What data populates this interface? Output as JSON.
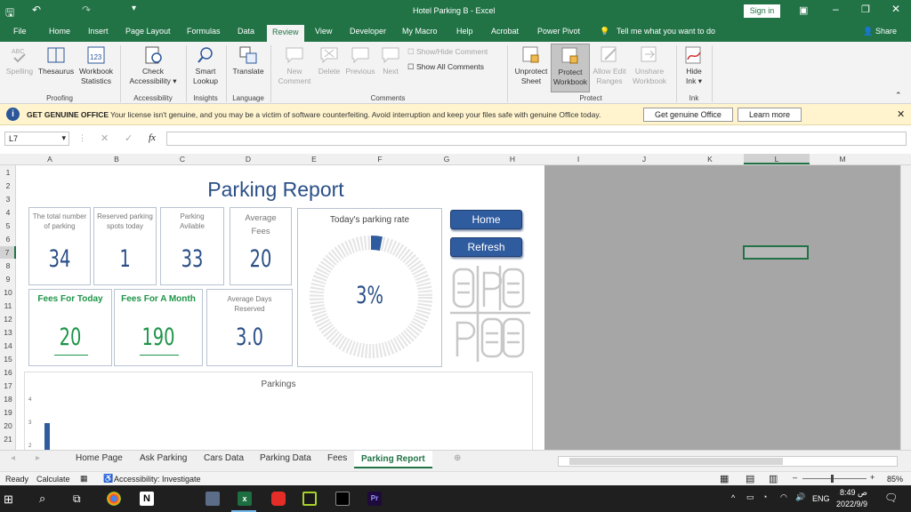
{
  "titlebar": {
    "title": "Hotel Parking B  -  Excel",
    "sign_in": "Sign in"
  },
  "menu": [
    "File",
    "Home",
    "Insert",
    "Page Layout",
    "Formulas",
    "Data",
    "Review",
    "View",
    "Developer",
    "My Macro",
    "Help",
    "Acrobat",
    "Power Pivot"
  ],
  "tell_me": "Tell me what you want to do",
  "share": "Share",
  "ribbon": {
    "spelling": "Spelling",
    "thesaurus": "Thesaurus",
    "wb_stats_1": "Workbook",
    "wb_stats_2": "Statistics",
    "proofing": "Proofing",
    "check_acc_1": "Check",
    "check_acc_2": "Accessibility",
    "accessibility": "Accessibility",
    "smart_1": "Smart",
    "smart_2": "Lookup",
    "insights": "Insights",
    "translate": "Translate",
    "language": "Language",
    "new_comment_1": "New",
    "new_comment_2": "Comment",
    "delete": "Delete",
    "previous": "Previous",
    "next": "Next",
    "show_hide": "Show/Hide Comment",
    "show_all": "Show All Comments",
    "comments": "Comments",
    "unprotect_1": "Unprotect",
    "unprotect_2": "Sheet",
    "protect_wb_1": "Protect",
    "protect_wb_2": "Workbook",
    "allow_1": "Allow Edit",
    "allow_2": "Ranges",
    "unshare_1": "Unshare",
    "unshare_2": "Workbook",
    "protect": "Protect",
    "hide_ink_1": "Hide",
    "hide_ink_2": "Ink",
    "ink": "Ink"
  },
  "info": {
    "title": "GET GENUINE OFFICE",
    "msg": "Your license isn't genuine, and you may be a victim of software counterfeiting. Avoid interruption and keep your files safe with genuine Office today.",
    "btn1": "Get genuine Office",
    "btn2": "Learn more"
  },
  "namebox": "L7",
  "columns": [
    "A",
    "B",
    "C",
    "D",
    "E",
    "F",
    "G",
    "H",
    "I",
    "J",
    "K",
    "L",
    "M"
  ],
  "rows": [
    "1",
    "2",
    "3",
    "4",
    "5",
    "6",
    "7",
    "8",
    "9",
    "10",
    "11",
    "12",
    "13",
    "14",
    "15",
    "16",
    "17",
    "18",
    "19",
    "20",
    "21"
  ],
  "report": {
    "title": "Parking Report",
    "total_label": "The total number of parking",
    "total": "34",
    "reserved_label": "Reserved parking spots today",
    "reserved": "1",
    "available_label": "Parking Avilable",
    "available": "33",
    "avg_fees_label": "Average Fees",
    "avg_fees": "20",
    "fees_today_label": "Fees For Today",
    "fees_today": "20",
    "fees_month_label": "Fees For A Month",
    "fees_month": "190",
    "avg_days_label": "Average Days Reserved",
    "avg_days": "3.0",
    "rate_label": "Today's parking rate",
    "rate": "3%",
    "rate_fraction": 0.03,
    "home": "Home",
    "refresh": "Refresh",
    "chart_title": "Parkings"
  },
  "chart_data": {
    "type": "bar",
    "title": "Parkings",
    "yticks": [
      "4",
      "3",
      "2"
    ],
    "values": [
      3
    ]
  },
  "tabs": [
    "Home Page",
    "Ask Parking",
    "Cars Data",
    "Parking Data",
    "Fees",
    "Parking Report"
  ],
  "status": {
    "ready": "Ready",
    "calculate": "Calculate",
    "acc": "Accessibility: Investigate",
    "zoom": "85%"
  },
  "taskbar": {
    "lang": "ENG",
    "time": "8:49 ص",
    "date": "2022/9/9"
  }
}
